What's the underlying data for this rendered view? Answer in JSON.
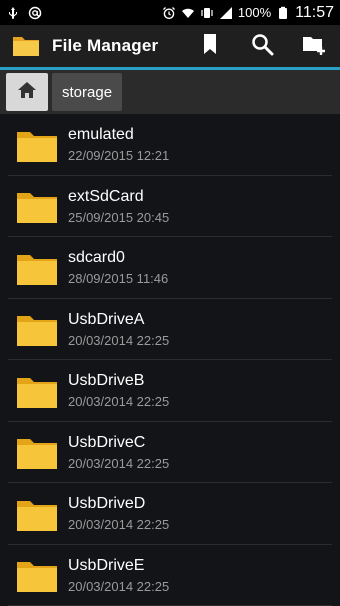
{
  "status_bar": {
    "left_icons": [
      "usb-icon",
      "at-icon"
    ],
    "right_icons": [
      "alarm-icon",
      "wifi-icon",
      "vibrate-icon",
      "signal-icon"
    ],
    "battery": "100%",
    "time": "11:57"
  },
  "action_bar": {
    "title": "File Manager",
    "icons": [
      "bookmark-icon",
      "search-icon",
      "new-folder-icon"
    ],
    "accent_color": "#2aa0c9"
  },
  "breadcrumb": {
    "home_icon": "home-icon",
    "items": [
      {
        "label": "storage"
      }
    ]
  },
  "files": [
    {
      "name": "emulated",
      "date": "22/09/2015 12:21"
    },
    {
      "name": "extSdCard",
      "date": "25/09/2015 20:45"
    },
    {
      "name": "sdcard0",
      "date": "28/09/2015 11:46"
    },
    {
      "name": "UsbDriveA",
      "date": "20/03/2014 22:25"
    },
    {
      "name": "UsbDriveB",
      "date": "20/03/2014 22:25"
    },
    {
      "name": "UsbDriveC",
      "date": "20/03/2014 22:25"
    },
    {
      "name": "UsbDriveD",
      "date": "20/03/2014 22:25"
    },
    {
      "name": "UsbDriveE",
      "date": "20/03/2014 22:25"
    }
  ]
}
